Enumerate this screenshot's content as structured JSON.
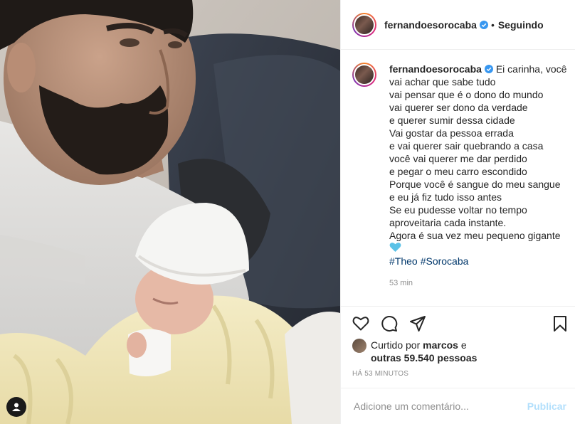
{
  "post": {
    "username": "fernandoesorocaba",
    "follow_status": "Seguindo",
    "caption_first": "Ei carinha, você",
    "caption_lines": [
      "vai achar que sabe tudo",
      "vai pensar que é o dono do mundo",
      "vai querer ser dono da verdade",
      "e querer sumir dessa cidade",
      "Vai gostar da pessoa errada",
      "e vai querer sair quebrando a casa",
      "você vai querer me dar perdido",
      "e pegar o meu carro escondido",
      "Porque você é sangue do meu sangue",
      "e eu já fiz tudo isso antes",
      "Se eu pudesse voltar no tempo",
      "aproveitaria cada instante.",
      "Agora é sua vez meu pequeno gigante"
    ],
    "hashtags": [
      "#Theo",
      "#Sorocaba"
    ],
    "caption_time": "53 min",
    "likes": {
      "prefix": "Curtido por",
      "user": "marcos",
      "middle": "e",
      "others": "outras 59.540 pessoas"
    },
    "time_ago": "HÁ 53 MINUTOS",
    "comment_placeholder": "Adicione um comentário...",
    "publish_label": "Publicar"
  },
  "icons": {
    "verified": "verified-badge-icon",
    "heart_emoji": "blue-heart-icon",
    "like": "heart-icon",
    "comment": "comment-icon",
    "share": "share-icon",
    "save": "bookmark-icon",
    "user_tag": "user-tag-icon"
  },
  "colors": {
    "verified": "#3897f0",
    "link": "#00376b",
    "publish_disabled": "#b2dffc",
    "heart_blue": "#5bc2e7"
  }
}
